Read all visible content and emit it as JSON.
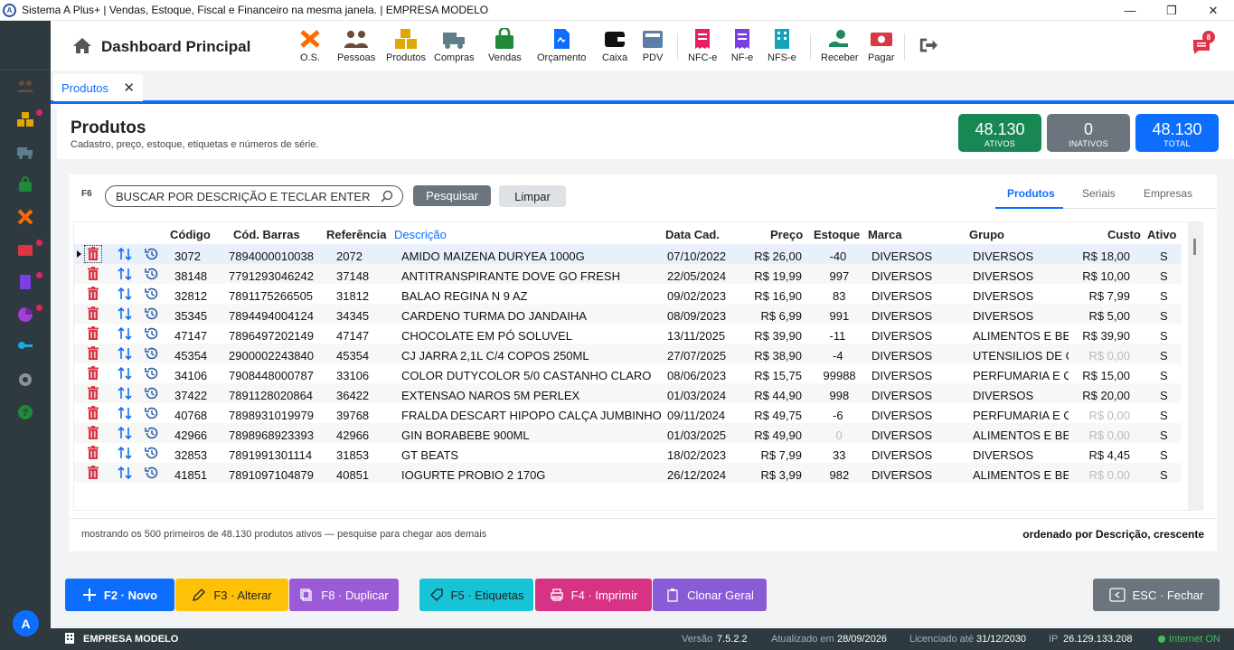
{
  "window": {
    "title": "Sistema A Plus+ | Vendas, Estoque, Fiscal e Financeiro na mesma janela. | EMPRESA MODELO",
    "min": "—",
    "max": "❐",
    "close": "✕"
  },
  "toolbar": {
    "dashboard_title": "Dashboard Principal",
    "items": [
      {
        "label": "O.S.",
        "icon": "tools-icon",
        "color": "#ff6a00"
      },
      {
        "label": "Pessoas",
        "icon": "people-icon",
        "color": "#6b4a3a"
      },
      {
        "label": "Produtos",
        "icon": "boxes-icon",
        "color": "#e0a800"
      },
      {
        "label": "Compras",
        "icon": "truck-icon",
        "color": "#607d8b"
      },
      {
        "label": "Vendas",
        "icon": "bag-icon",
        "color": "#1e8a3a"
      },
      {
        "label": "Orçamento",
        "icon": "document-icon",
        "color": "#0d6efd"
      },
      {
        "label": "Caixa",
        "icon": "wallet-icon",
        "color": "#111111"
      },
      {
        "label": "PDV",
        "icon": "register-icon",
        "color": "#5b7fa6"
      },
      {
        "label": "NFC-e",
        "icon": "receipt-icon",
        "color": "#e91e63"
      },
      {
        "label": "NF-e",
        "icon": "receipt-icon",
        "color": "#7b3fe4"
      },
      {
        "label": "NFS-e",
        "icon": "building-icon",
        "color": "#17a2b8"
      },
      {
        "label": "Receber",
        "icon": "hand-money-icon",
        "color": "#1e8a5a"
      },
      {
        "label": "Pagar",
        "icon": "money-icon",
        "color": "#dc3545"
      }
    ],
    "notifications_count": "8"
  },
  "tab": {
    "label": "Produtos",
    "close": "✕"
  },
  "header": {
    "title": "Produtos",
    "subtitle": "Cadastro, preço, estoque, etiquetas e números de série.",
    "stats": [
      {
        "value": "48.130",
        "label": "ATIVOS",
        "color": "#198754"
      },
      {
        "value": "0",
        "label": "INATIVOS",
        "color": "#6c757d"
      },
      {
        "value": "48.130",
        "label": "TOTAL",
        "color": "#0d6efd"
      }
    ]
  },
  "search": {
    "shortcut": "F6",
    "placeholder": "BUSCAR POR DESCRIÇÃO E TECLAR ENTER",
    "search_label": "Pesquisar",
    "clear_label": "Limpar"
  },
  "views": {
    "tabs": [
      "Produtos",
      "Seriais",
      "Empresas"
    ],
    "active": "Produtos"
  },
  "table": {
    "columns": [
      "Código",
      "Cód. Barras",
      "Referência",
      "Descrição",
      "Data Cad.",
      "Preço",
      "Estoque",
      "Marca",
      "Grupo",
      "Custo",
      "Ativo"
    ],
    "rows": [
      [
        "3072",
        "7894000010038",
        "2072",
        "AMIDO MAIZENA DURYEA  1000G",
        "07/10/2022",
        "R$ 26,00",
        "-40",
        "DIVERSOS",
        "DIVERSOS",
        "R$ 18,00",
        "S"
      ],
      [
        "38148",
        "7791293046242",
        "37148",
        "ANTITRANSPIRANTE DOVE GO FRESH",
        "22/05/2024",
        "R$ 19,99",
        "997",
        "DIVERSOS",
        "DIVERSOS",
        "R$ 10,00",
        "S"
      ],
      [
        "32812",
        "7891175266505",
        "31812",
        "BALAO REGINA N 9 AZ",
        "09/02/2023",
        "R$ 16,90",
        "83",
        "DIVERSOS",
        "DIVERSOS",
        "R$ 7,99",
        "S"
      ],
      [
        "35345",
        "7894494004124",
        "34345",
        "CARDENO TURMA DO JANDAIHA",
        "08/09/2023",
        "R$ 6,99",
        "991",
        "DIVERSOS",
        "DIVERSOS",
        "R$ 5,00",
        "S"
      ],
      [
        "47147",
        "7896497202149",
        "47147",
        "CHOCOLATE EM PÓ SOLUVEL",
        "13/11/2025",
        "R$ 39,90",
        "-11",
        "DIVERSOS",
        "ALIMENTOS E BEB",
        "R$ 39,90",
        "S"
      ],
      [
        "45354",
        "2900002243840",
        "45354",
        "CJ JARRA 2,1L C/4 COPOS 250ML",
        "27/07/2025",
        "R$ 38,90",
        "-4",
        "DIVERSOS",
        "UTENSILIOS DE CA",
        "R$ 0,00",
        "S"
      ],
      [
        "34106",
        "7908448000787",
        "33106",
        "COLOR DUTYCOLOR 5/0 CASTANHO CLARO",
        "08/06/2023",
        "R$ 15,75",
        "99988",
        "DIVERSOS",
        "PERFUMARIA E CC",
        "R$ 15,00",
        "S"
      ],
      [
        "37422",
        "7891128020864",
        "36422",
        "EXTENSAO  NAROS 5M PERLEX",
        "01/03/2024",
        "R$ 44,90",
        "998",
        "DIVERSOS",
        "DIVERSOS",
        "R$ 20,00",
        "S"
      ],
      [
        "40768",
        "7898931019979",
        "39768",
        "FRALDA DESCART HIPOPO CALÇA JUMBINHO G C",
        "09/11/2024",
        "R$ 49,75",
        "-6",
        "DIVERSOS",
        "PERFUMARIA E CC",
        "R$ 0,00",
        "S"
      ],
      [
        "42966",
        "7898968923393",
        "42966",
        "GIN BORABEBE 900ML",
        "01/03/2025",
        "R$ 49,90",
        "0",
        "DIVERSOS",
        "ALIMENTOS E BEB",
        "R$ 0,00",
        "S"
      ],
      [
        "32853",
        "7891991301114",
        "31853",
        "GT BEATS",
        "18/02/2023",
        "R$ 7,99",
        "33",
        "DIVERSOS",
        "DIVERSOS",
        "R$ 4,45",
        "S"
      ],
      [
        "41851",
        "7891097104879",
        "40851",
        "IOGURTE PROBIO 2 170G",
        "26/12/2024",
        "R$ 3,99",
        "982",
        "DIVERSOS",
        "ALIMENTOS E BEB",
        "R$ 0,00",
        "S"
      ]
    ]
  },
  "footer": {
    "left": "mostrando os 500 primeiros de 48.130 produtos ativos — pesquise para chegar aos demais",
    "right": "ordenado por Descrição, crescente"
  },
  "actions": [
    {
      "label": "F2 · Novo",
      "color": "#0d6efd"
    },
    {
      "label": "F3 · Alterar",
      "color": "#ffc107"
    },
    {
      "label": "F8 · Duplicar",
      "color": "#9c5bd6"
    },
    {
      "label": "F5 · Etiquetas",
      "color": "#17c3d6"
    },
    {
      "label": "F4 · Imprimir",
      "color": "#d63384"
    },
    {
      "label": "Clonar Geral",
      "color": "#8a5bd6"
    },
    {
      "label": "ESC · Fechar",
      "color": "#6c757d"
    }
  ],
  "status": {
    "company": "EMPRESA MODELO",
    "version_label": "Versão",
    "version": "7.5.2.2",
    "updated_label": "Atualizado em",
    "updated": "28/09/2026",
    "license_label": "Licenciado até",
    "license": "31/12/2030",
    "ip_label": "IP",
    "ip": "26.129.133.208",
    "internet": "Internet ON"
  },
  "sidebar": {
    "avatar": "A"
  }
}
